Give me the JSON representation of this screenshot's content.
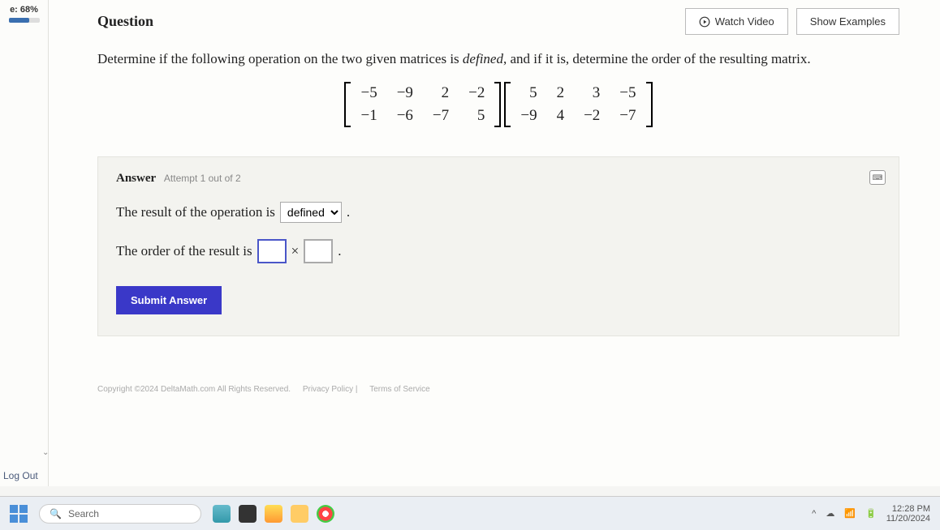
{
  "sidebar": {
    "progress_label": "e: 68%",
    "logout": "Log Out"
  },
  "header": {
    "title": "Question",
    "watch_video": "Watch Video",
    "show_examples": "Show Examples"
  },
  "prompt": {
    "before_defined": "Determine if the following operation on the two given matrices is ",
    "defined_word": "defined",
    "after_defined": ", and if it is, determine the order of the resulting matrix."
  },
  "matrices": {
    "A": [
      [
        -5,
        -9,
        2,
        -2
      ],
      [
        -1,
        -6,
        -7,
        5
      ]
    ],
    "B": [
      [
        5,
        2,
        3,
        -5
      ],
      [
        -9,
        4,
        -2,
        -7
      ]
    ]
  },
  "answer": {
    "label": "Answer",
    "attempt": "Attempt 1 out of 2",
    "line1_prefix": "The result of the operation is",
    "dropdown_value": "defined",
    "line1_suffix": ".",
    "line2_prefix": "The order of the result is",
    "times": "×",
    "line2_suffix": ".",
    "submit": "Submit Answer"
  },
  "footer": {
    "copyright": "Copyright ©2024 DeltaMath.com All Rights Reserved.",
    "privacy": "Privacy Policy",
    "terms": "Terms of Service"
  },
  "taskbar": {
    "search_placeholder": "Search",
    "time": "12:28 PM",
    "date": "11/20/2024"
  }
}
